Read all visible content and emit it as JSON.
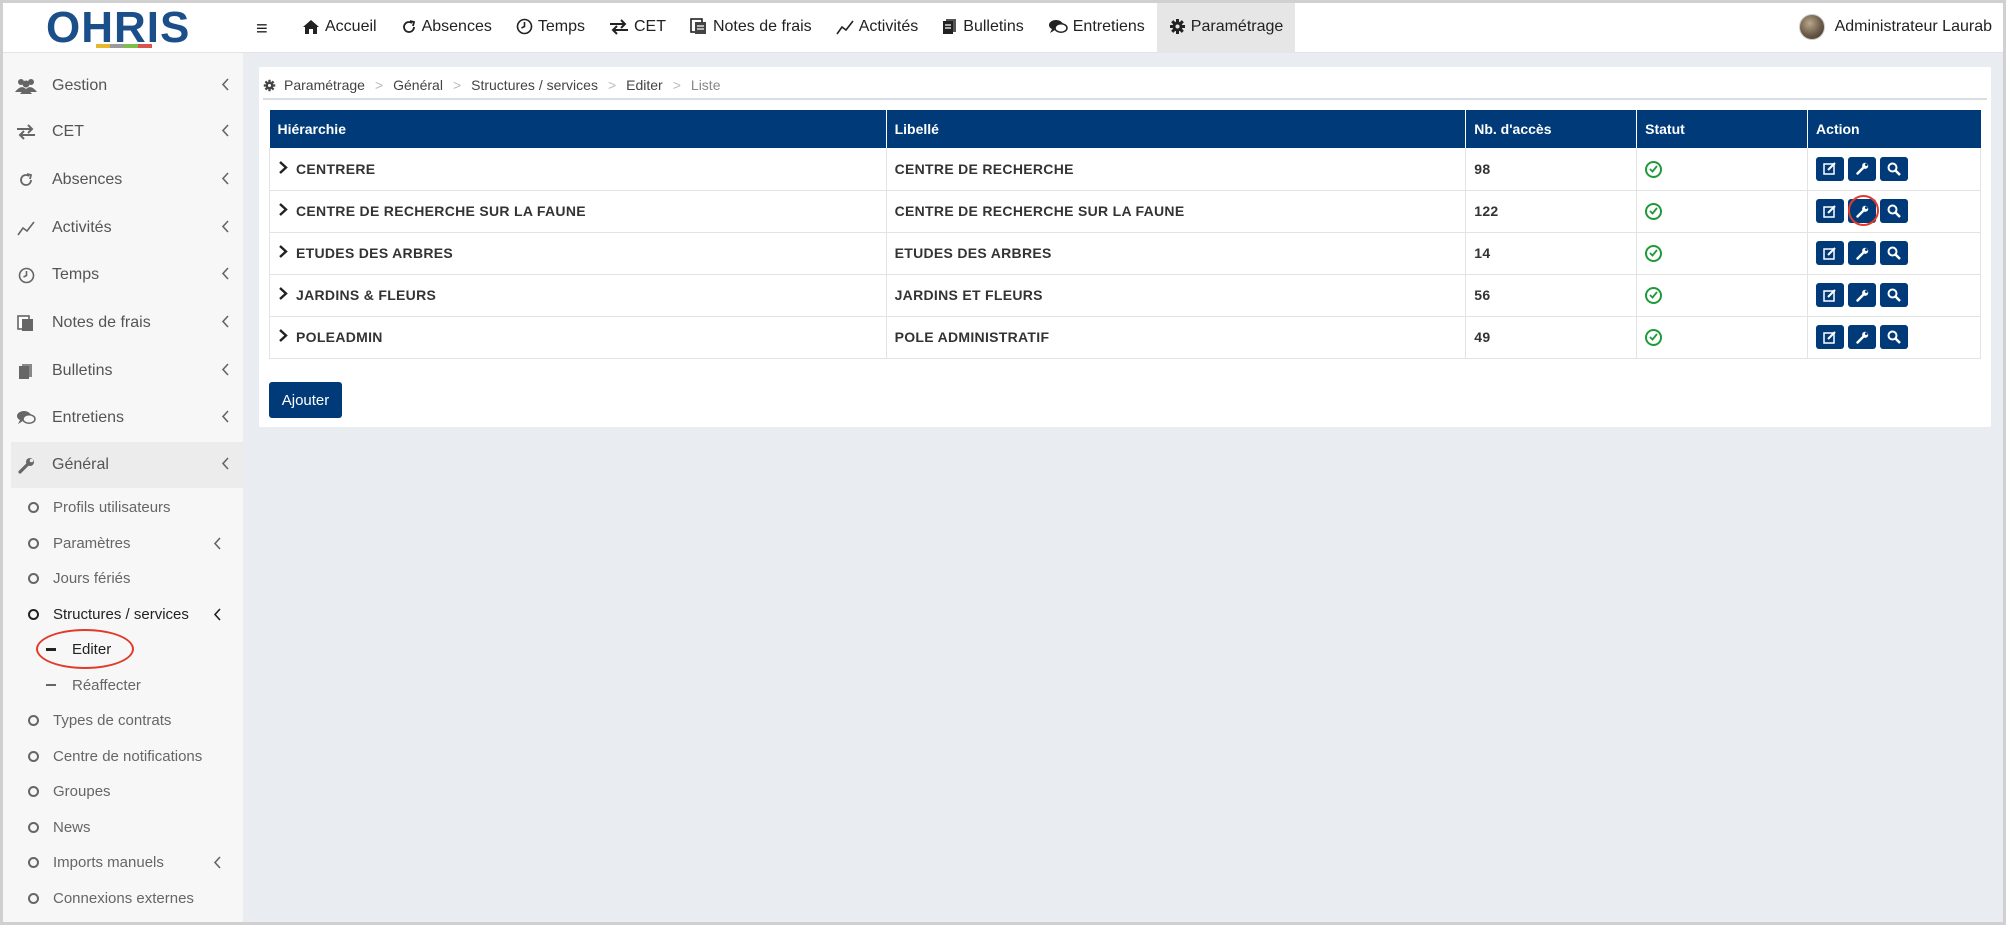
{
  "app": {
    "logo_text": "OHRIS"
  },
  "topnav": [
    {
      "label": "Accueil",
      "icon": "home-icon"
    },
    {
      "label": "Absences",
      "icon": "refresh-icon"
    },
    {
      "label": "Temps",
      "icon": "clock-icon"
    },
    {
      "label": "CET",
      "icon": "exchange-icon"
    },
    {
      "label": "Notes de frais",
      "icon": "receipt-icon"
    },
    {
      "label": "Activités",
      "icon": "line-chart-icon"
    },
    {
      "label": "Bulletins",
      "icon": "document-icon"
    },
    {
      "label": "Entretiens",
      "icon": "comments-icon"
    },
    {
      "label": "Paramétrage",
      "icon": "gear-icon"
    }
  ],
  "user": {
    "name": "Administrateur Laurab"
  },
  "sidebar": {
    "items": [
      {
        "label": "Gestion"
      },
      {
        "label": "CET"
      },
      {
        "label": "Absences"
      },
      {
        "label": "Activités"
      },
      {
        "label": "Temps"
      },
      {
        "label": "Notes de frais"
      },
      {
        "label": "Bulletins"
      },
      {
        "label": "Entretiens"
      },
      {
        "label": "Général"
      }
    ],
    "sub": [
      {
        "label": "Profils utilisateurs"
      },
      {
        "label": "Paramètres"
      },
      {
        "label": "Jours fériés"
      },
      {
        "label": "Structures / services"
      },
      {
        "label": "Types de contrats"
      },
      {
        "label": "Centre de notifications"
      },
      {
        "label": "Groupes"
      },
      {
        "label": "News"
      },
      {
        "label": "Imports manuels"
      },
      {
        "label": "Connexions externes"
      }
    ],
    "subsub": [
      {
        "label": "Editer"
      },
      {
        "label": "Réaffecter"
      }
    ]
  },
  "breadcrumb": [
    "Paramétrage",
    "Général",
    "Structures / services",
    "Editer",
    "Liste"
  ],
  "table": {
    "headers": [
      "Hiérarchie",
      "Libellé",
      "Nb. d'accès",
      "Statut",
      "Action"
    ],
    "rows": [
      {
        "code": "CENTRERE",
        "label": "CENTRE DE RECHERCHE",
        "access": "98"
      },
      {
        "code": "CENTRE DE RECHERCHE SUR LA FAUNE",
        "label": "CENTRE DE RECHERCHE SUR LA FAUNE",
        "access": "122"
      },
      {
        "code": "ETUDES DES ARBRES",
        "label": "ETUDES DES ARBRES",
        "access": "14"
      },
      {
        "code": "JARDINS & FLEURS",
        "label": "JARDINS ET FLEURS",
        "access": "56"
      },
      {
        "code": "POLEADMIN",
        "label": "POLE ADMINISTRATIF",
        "access": "49"
      }
    ]
  },
  "buttons": {
    "add": "Ajouter"
  },
  "colors": {
    "primary": "#003a79",
    "status_ok": "#1f9a3a",
    "highlight": "#e23a2a"
  }
}
